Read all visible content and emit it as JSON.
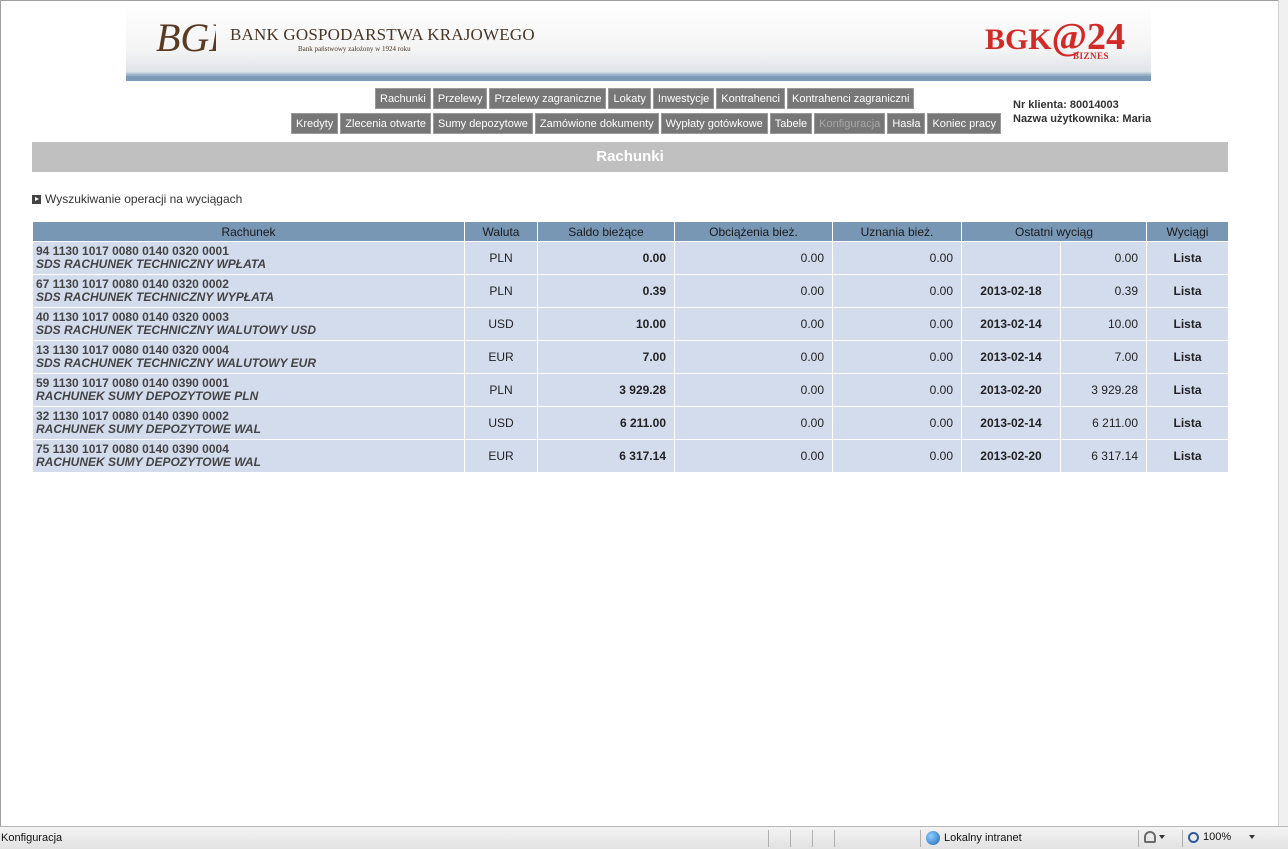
{
  "header": {
    "bank_name": "BANK GOSPODARSTWA KRAJOWEGO",
    "bank_subtitle": "Bank państwowy założony w 1924 roku",
    "logo_initials": "BGK",
    "product_logo": "BGK@24",
    "product_sub": "BIZNES"
  },
  "nav": {
    "row1": [
      "Rachunki",
      "Przelewy",
      "Przelewy zagraniczne",
      "Lokaty",
      "Inwestycje",
      "Kontrahenci",
      "Kontrahenci zagraniczni"
    ],
    "row2": [
      "Kredyty",
      "Zlecenia otwarte",
      "Sumy depozytowe",
      "Zamówione dokumenty",
      "Wypłaty gotówkowe",
      "Tabele",
      "Konfiguracja",
      "Hasła",
      "Koniec pracy"
    ],
    "disabled_item": "Konfiguracja"
  },
  "client": {
    "nr_label": "Nr klienta: 80014003",
    "user_label": "Nazwa użytkownika: Maria"
  },
  "page_title": "Rachunki",
  "search_link": "Wyszukiwanie operacji na wyciągach",
  "table": {
    "headers": [
      "Rachunek",
      "Waluta",
      "Saldo bieżące",
      "Obciążenia bież.",
      "Uznania bież.",
      "Ostatni wyciąg",
      "Wyciągi"
    ],
    "rows": [
      {
        "number": "94 1130 1017 0080 0140 0320 0001",
        "name": "SDS RACHUNEK TECHNICZNY WPŁATA",
        "currency": "PLN",
        "saldo": "0.00",
        "debits": "0.00",
        "credits": "0.00",
        "last_date": "",
        "last_amount": "0.00",
        "action": "Lista"
      },
      {
        "number": "67 1130 1017 0080 0140 0320 0002",
        "name": "SDS RACHUNEK TECHNICZNY WYPŁATA",
        "currency": "PLN",
        "saldo": "0.39",
        "debits": "0.00",
        "credits": "0.00",
        "last_date": "2013-02-18",
        "last_amount": "0.39",
        "action": "Lista"
      },
      {
        "number": "40 1130 1017 0080 0140 0320 0003",
        "name": "SDS RACHUNEK TECHNICZNY WALUTOWY USD",
        "currency": "USD",
        "saldo": "10.00",
        "debits": "0.00",
        "credits": "0.00",
        "last_date": "2013-02-14",
        "last_amount": "10.00",
        "action": "Lista"
      },
      {
        "number": "13 1130 1017 0080 0140 0320 0004",
        "name": "SDS RACHUNEK TECHNICZNY WALUTOWY EUR",
        "currency": "EUR",
        "saldo": "7.00",
        "debits": "0.00",
        "credits": "0.00",
        "last_date": "2013-02-14",
        "last_amount": "7.00",
        "action": "Lista"
      },
      {
        "number": "59 1130 1017 0080 0140 0390 0001",
        "name": "RACHUNEK SUMY DEPOZYTOWE PLN",
        "currency": "PLN",
        "saldo": "3 929.28",
        "debits": "0.00",
        "credits": "0.00",
        "last_date": "2013-02-20",
        "last_amount": "3 929.28",
        "action": "Lista"
      },
      {
        "number": "32 1130 1017 0080 0140 0390 0002",
        "name": "RACHUNEK SUMY DEPOZYTOWE WAL",
        "currency": "USD",
        "saldo": "6 211.00",
        "debits": "0.00",
        "credits": "0.00",
        "last_date": "2013-02-14",
        "last_amount": "6 211.00",
        "action": "Lista"
      },
      {
        "number": "75 1130 1017 0080 0140 0390 0004",
        "name": "RACHUNEK SUMY DEPOZYTOWE WAL",
        "currency": "EUR",
        "saldo": "6 317.14",
        "debits": "0.00",
        "credits": "0.00",
        "last_date": "2013-02-20",
        "last_amount": "6 317.14",
        "action": "Lista"
      }
    ]
  },
  "statusbar": {
    "text": "Konfiguracja",
    "zone": "Lokalny intranet",
    "zoom": "100%"
  }
}
